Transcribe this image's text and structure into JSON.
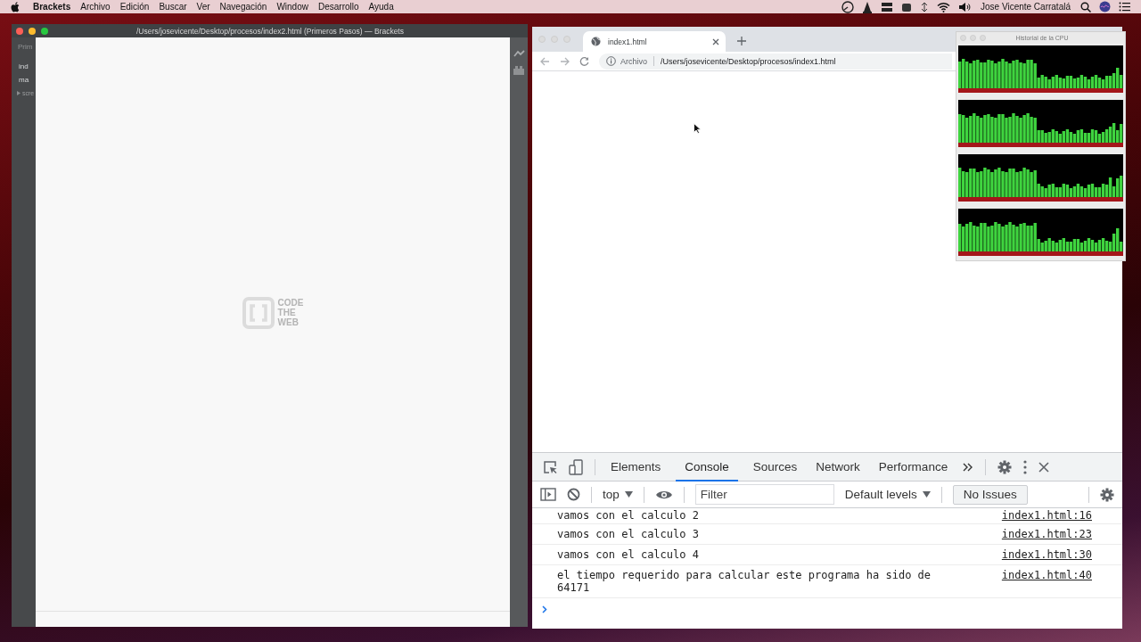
{
  "menubar": {
    "app_name": "Brackets",
    "menus": [
      "Archivo",
      "Edición",
      "Buscar",
      "Ver",
      "Navegación",
      "Window",
      "Desarrollo",
      "Ayuda"
    ],
    "user_name": "Jose Vicente Carratalá"
  },
  "editor_window": {
    "title": "/Users/josevicente/Desktop/procesos/index2.html (Primeros Pasos) — Brackets",
    "sidebar_header": "Prim",
    "files": [
      {
        "name": "ind",
        "kind": "file"
      },
      {
        "name": "ma",
        "kind": "file"
      },
      {
        "name": "scre",
        "kind": "folder"
      }
    ],
    "logo_lines": [
      "CODE",
      "THE",
      "WEB"
    ]
  },
  "browser": {
    "tabs": [
      {
        "title": "index1.html",
        "selected": true
      }
    ],
    "address": {
      "scheme_label": "Archivo",
      "url": "/Users/josevicente/Desktop/procesos/index1.html"
    },
    "devtools": {
      "tabs": [
        {
          "label": "Elements",
          "selected": false
        },
        {
          "label": "Console",
          "selected": true
        },
        {
          "label": "Sources",
          "selected": false
        },
        {
          "label": "Network",
          "selected": false
        },
        {
          "label": "Performance",
          "selected": false
        }
      ],
      "context": "top",
      "filter_placeholder": "Filter",
      "levels": "Default levels",
      "issues": "No Issues",
      "messages": [
        {
          "text": "vamos con el calculo 2",
          "source": "index1.html:16"
        },
        {
          "text": "vamos con el calculo 3",
          "source": "index1.html:23"
        },
        {
          "text": "vamos con el calculo 4",
          "source": "index1.html:30"
        },
        {
          "text": "el tiempo requerido para calcular este programa ha sido de 64171",
          "source": "index1.html:40"
        }
      ]
    }
  },
  "cpu_window": {
    "title": "Historial de la CPU"
  }
}
